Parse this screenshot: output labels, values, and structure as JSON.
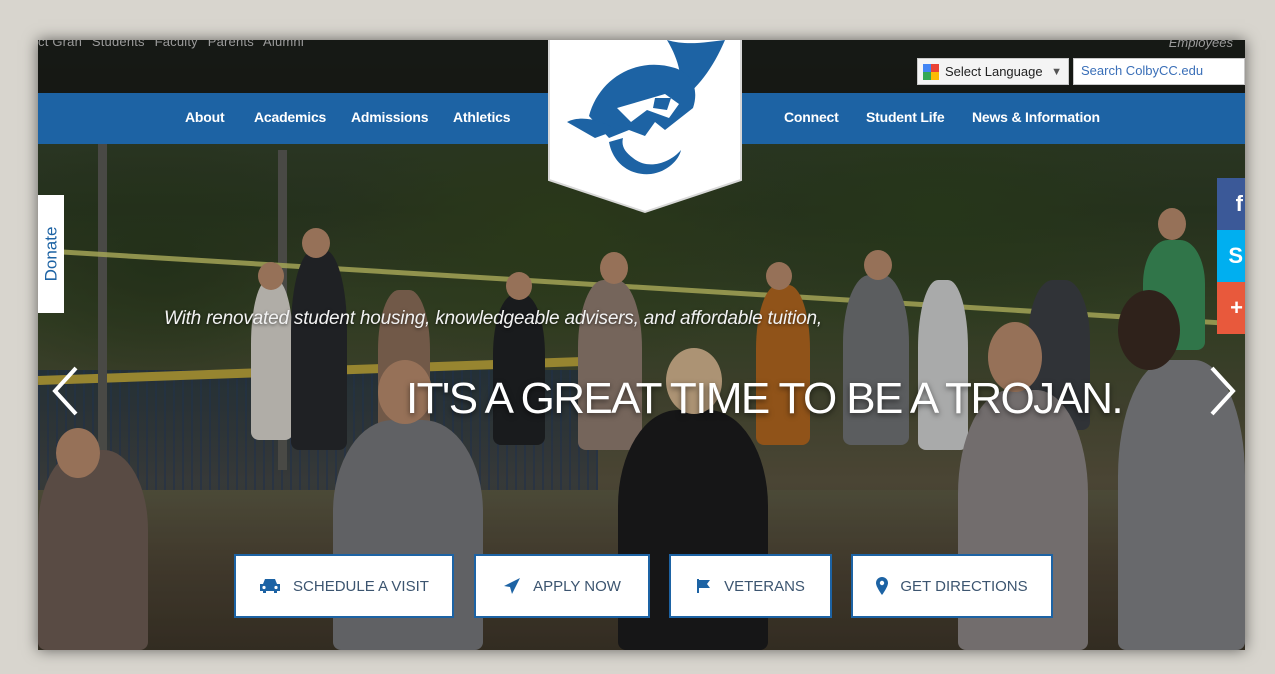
{
  "utility_bar": {
    "links": [
      "ct Gran",
      "Students",
      "Faculty",
      "Parents",
      "Alumni"
    ],
    "employees_label": "Employees"
  },
  "language_selector": {
    "label": "Select Language",
    "arrow": "▼"
  },
  "search": {
    "placeholder": "Search ColbyCC.edu"
  },
  "nav": {
    "left": [
      "About",
      "Academics",
      "Admissions",
      "Athletics"
    ],
    "right": [
      "Connect",
      "Student Life",
      "News & Information"
    ]
  },
  "logo": {
    "icon": "trojan-helmet-logo",
    "colors": {
      "blue": "#1d63a4",
      "white": "#ffffff"
    }
  },
  "donate_label": "Donate",
  "social": [
    {
      "icon": "facebook-icon",
      "glyph": "f",
      "color": "#3b5998"
    },
    {
      "icon": "skype-icon",
      "glyph": "S",
      "color": "#00aff0"
    },
    {
      "icon": "plus-icon",
      "glyph": "+",
      "color": "#e8593c"
    }
  ],
  "hero": {
    "tagline": "With renovated student housing, knowledgeable advisers, and affordable tuition,",
    "headline": "IT'S A GREAT TIME TO BE A TROJAN.",
    "prev_icon": "chevron-left-icon",
    "next_icon": "chevron-right-icon"
  },
  "cta_buttons": [
    {
      "label": "SCHEDULE A VISIT",
      "icon": "car-icon"
    },
    {
      "label": "APPLY NOW",
      "icon": "paper-plane-icon"
    },
    {
      "label": "VETERANS",
      "icon": "flag-icon"
    },
    {
      "label": "GET DIRECTIONS",
      "icon": "map-marker-icon"
    }
  ],
  "accent_color": "#1d63a4"
}
